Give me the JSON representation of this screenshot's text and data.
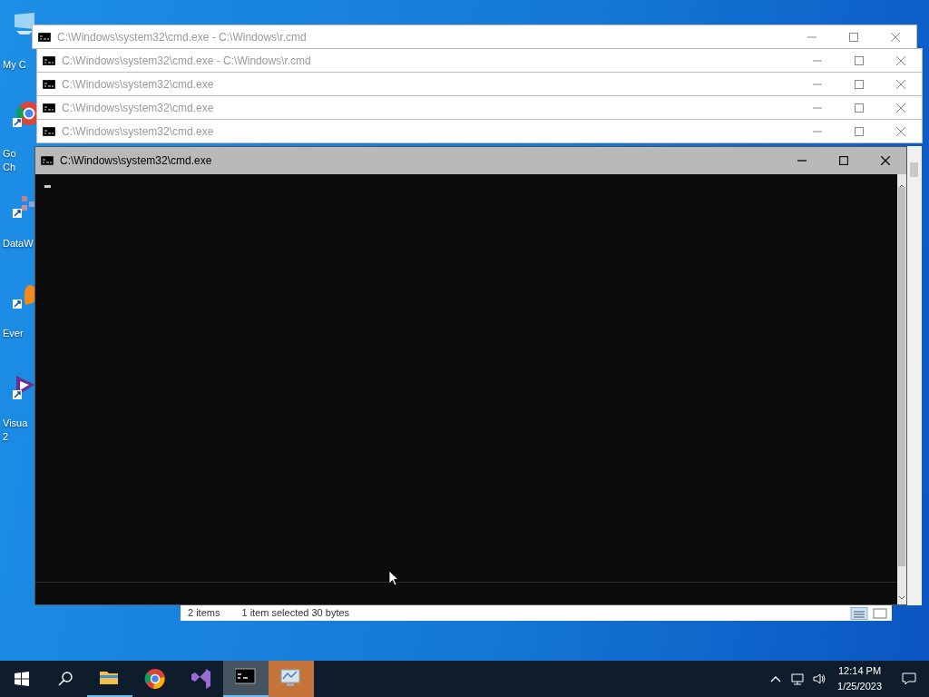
{
  "desktop_icons": [
    {
      "kind": "computer",
      "lines": [
        "My C"
      ]
    },
    {
      "kind": "chrome",
      "lines": [
        "Go",
        "Ch"
      ]
    },
    {
      "kind": "dataw",
      "lines": [
        "DataW"
      ]
    },
    {
      "kind": "ever",
      "lines": [
        "Ever"
      ]
    },
    {
      "kind": "vs",
      "lines": [
        "Visua",
        "2"
      ]
    }
  ],
  "explorer_status": {
    "items": "2 items",
    "selection": "1 item selected  30 bytes"
  },
  "windows": [
    {
      "title": "C:\\Windows\\system32\\cmd.exe - C:\\Windows\\r.cmd",
      "active": false
    },
    {
      "title": "C:\\Windows\\system32\\cmd.exe - C:\\Windows\\r.cmd",
      "active": false
    },
    {
      "title": "C:\\Windows\\system32\\cmd.exe",
      "active": false
    },
    {
      "title": "C:\\Windows\\system32\\cmd.exe",
      "active": false
    },
    {
      "title": "C:\\Windows\\system32\\cmd.exe",
      "active": false
    },
    {
      "title": "C:\\Windows\\system32\\cmd.exe",
      "active": true
    }
  ],
  "taskbar": {
    "apps": [
      {
        "kind": "explorer",
        "open": true,
        "selected": false,
        "flashing": false
      },
      {
        "kind": "chrome",
        "open": false,
        "selected": false,
        "flashing": false
      },
      {
        "kind": "vs",
        "open": false,
        "selected": false,
        "flashing": false
      },
      {
        "kind": "cmd",
        "open": true,
        "selected": true,
        "flashing": false
      },
      {
        "kind": "monitor",
        "open": false,
        "selected": false,
        "flashing": true
      }
    ],
    "time": "12:14 PM",
    "date": "1/25/2023"
  }
}
